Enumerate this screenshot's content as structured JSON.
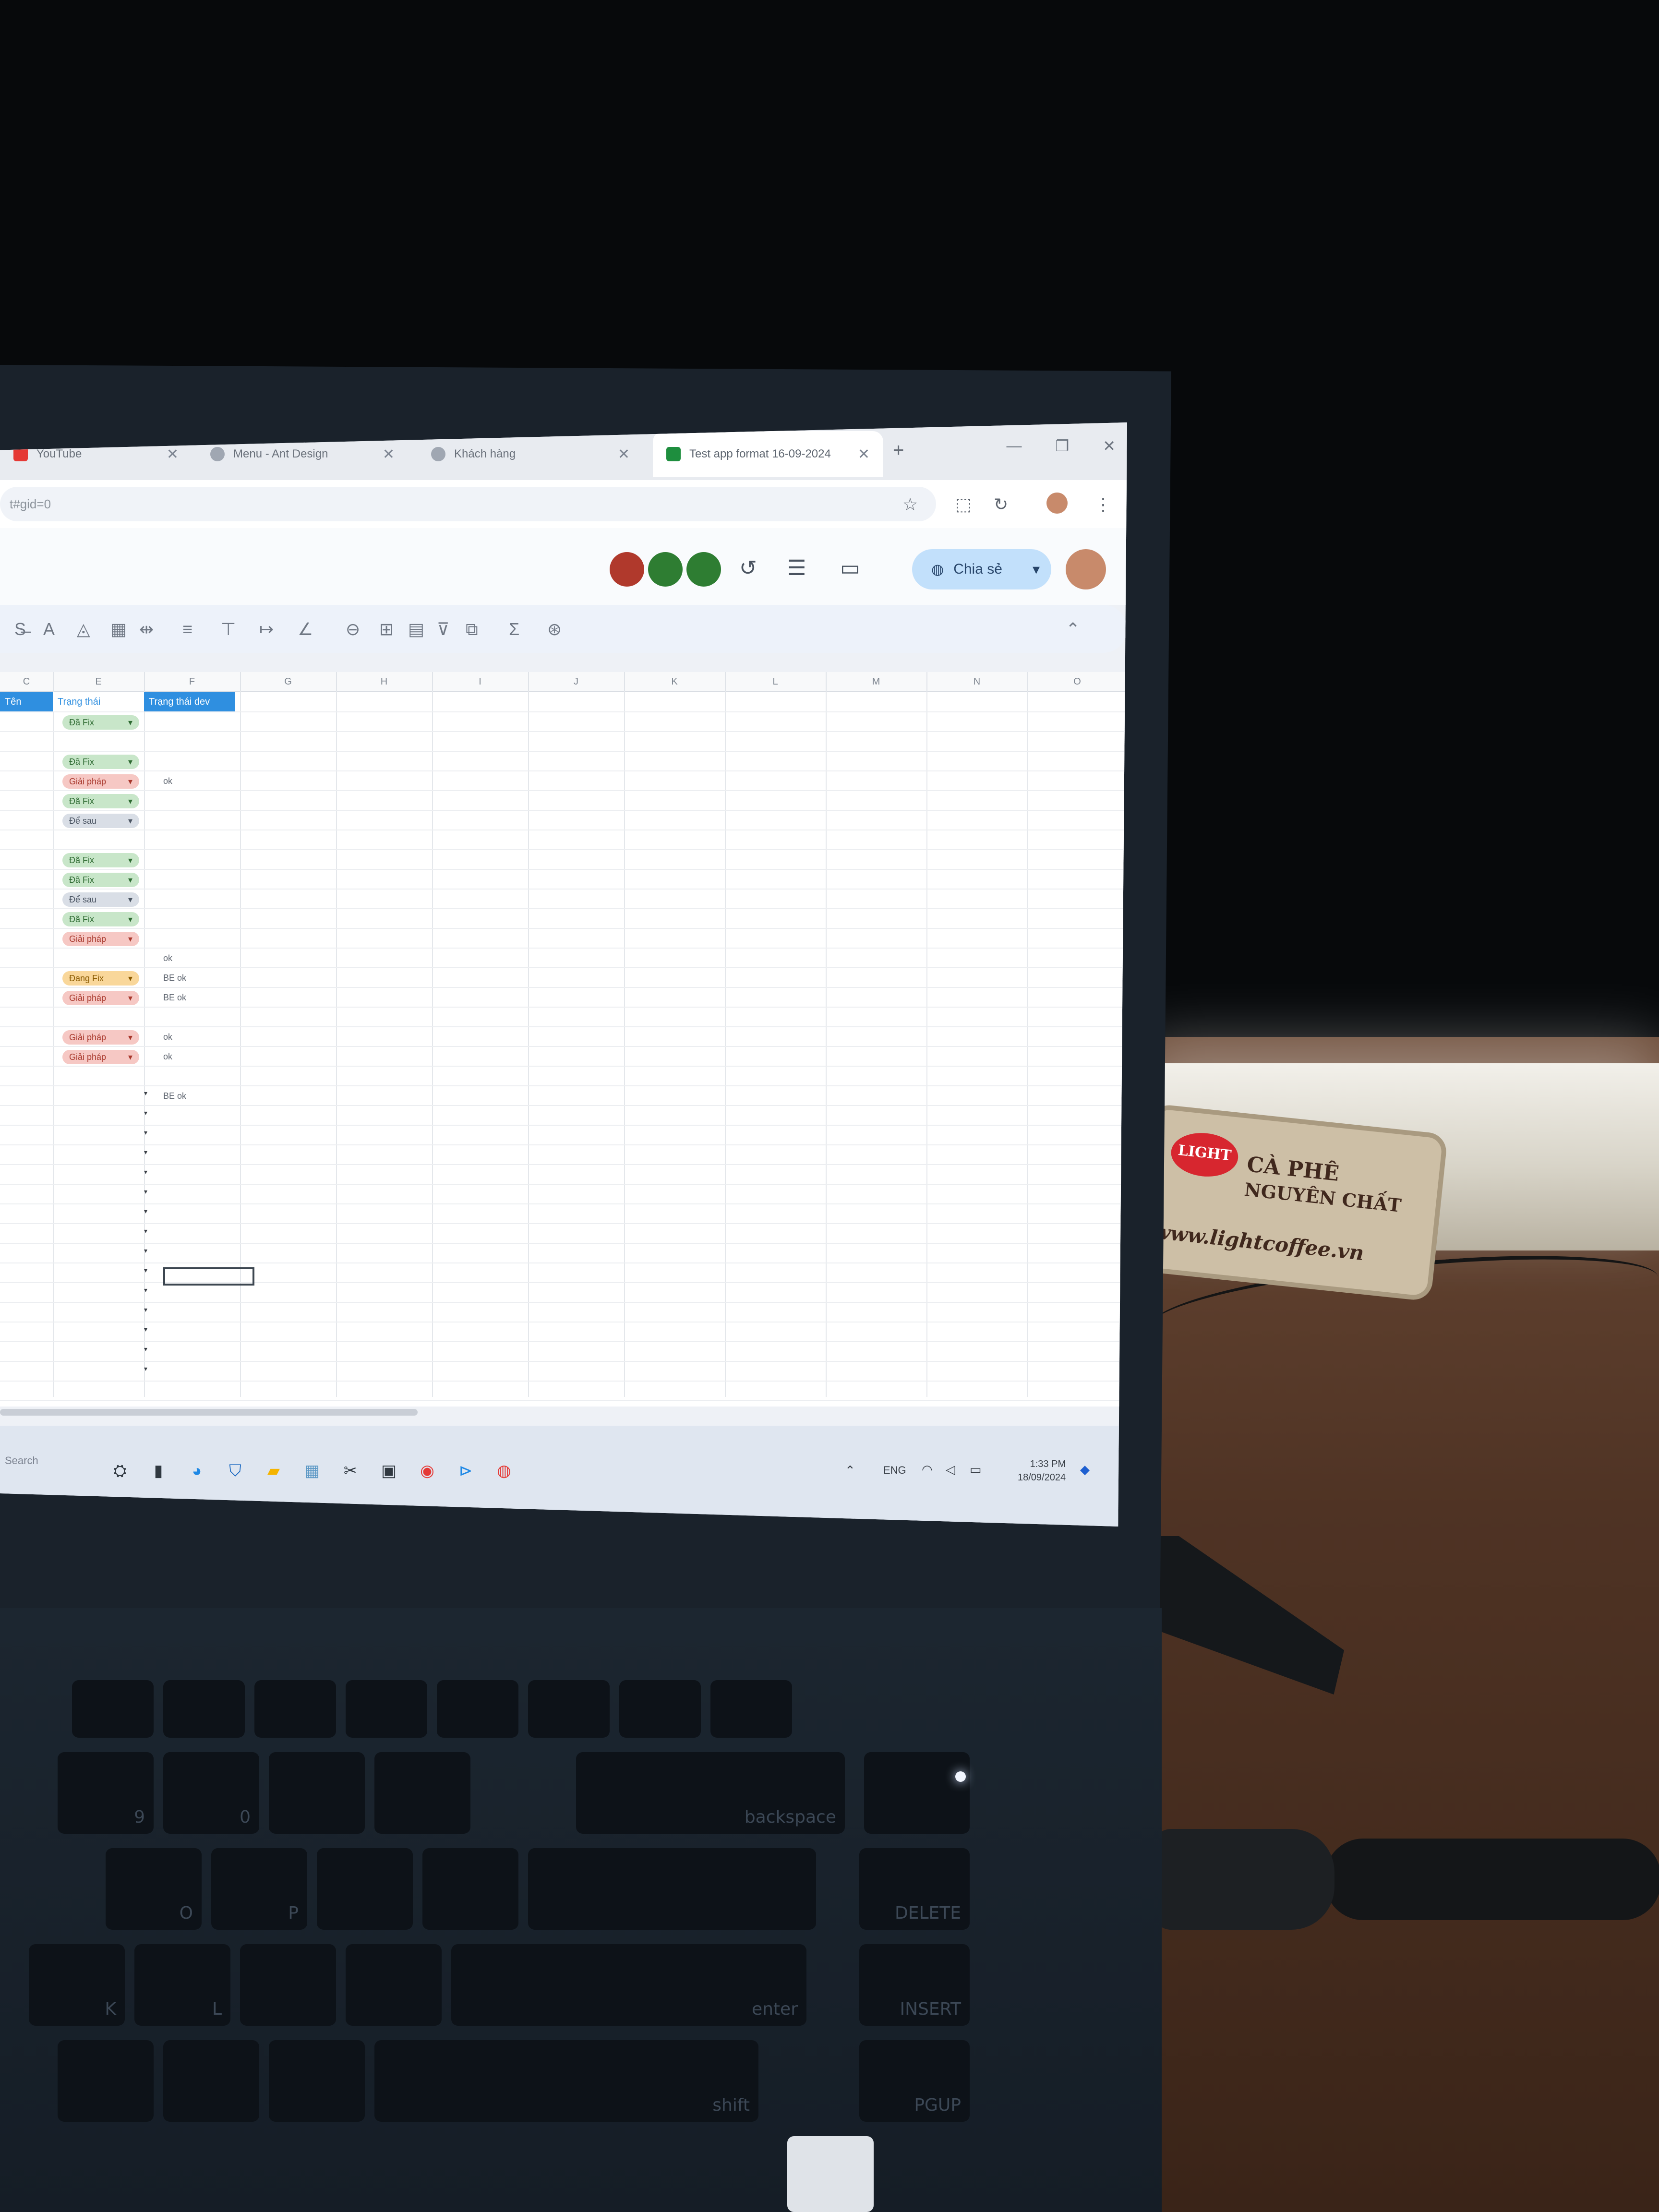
{
  "browser": {
    "tabs": [
      {
        "label": "YouTube",
        "favicon_color": "#e53935",
        "active": false
      },
      {
        "label": "Menu - Ant Design",
        "favicon_color": "#a0a7b2",
        "active": false
      },
      {
        "label": "Khách hàng",
        "favicon_color": "#a0a7b2",
        "active": false
      },
      {
        "label": "Test app format 16-09-2024",
        "favicon_color": "#1e8e3e",
        "active": true
      }
    ],
    "new_tab": "+",
    "window_controls": [
      "—",
      "❐",
      "✕"
    ],
    "url": "t#gid=0"
  },
  "sheets": {
    "share_label": "Chia sẻ",
    "collaborator_colors": [
      "#b0392c",
      "#2e7d32",
      "#2e7d32"
    ]
  },
  "grid": {
    "column_letters": [
      "C",
      "E",
      "F",
      "G",
      "H",
      "I",
      "J",
      "K",
      "L",
      "M",
      "N",
      "O"
    ],
    "headers": {
      "c": "Tên",
      "e": "Trạng thái",
      "f": "Trạng thái dev"
    },
    "status_rows": [
      {
        "label": "Đã Fix",
        "color": "green"
      },
      {
        "label": "",
        "color": "none"
      },
      {
        "label": "Đã Fix",
        "color": "green"
      },
      {
        "label": "Giải pháp",
        "color": "red"
      },
      {
        "label": "Đã Fix",
        "color": "green"
      },
      {
        "label": "Để sau",
        "color": "gray"
      },
      {
        "label": "",
        "color": "none"
      },
      {
        "label": "Đã Fix",
        "color": "green"
      },
      {
        "label": "Đã Fix",
        "color": "green"
      },
      {
        "label": "Để sau",
        "color": "gray"
      },
      {
        "label": "Đã Fix",
        "color": "green"
      },
      {
        "label": "Giải pháp",
        "color": "red"
      },
      {
        "label": "",
        "color": "none"
      },
      {
        "label": "Đang Fix",
        "color": "orange"
      },
      {
        "label": "Giải pháp",
        "color": "red"
      },
      {
        "label": "",
        "color": "none"
      },
      {
        "label": "Giải pháp",
        "color": "red"
      },
      {
        "label": "Giải pháp",
        "color": "red"
      }
    ],
    "dev_notes": [
      {
        "row": 3,
        "text": "ok"
      },
      {
        "row": 12,
        "text": "ok"
      },
      {
        "row": 13,
        "text": "BE ok"
      },
      {
        "row": 14,
        "text": "BE ok"
      },
      {
        "row": 16,
        "text": "ok"
      },
      {
        "row": 17,
        "text": "ok"
      },
      {
        "row": 19,
        "text": "BE ok"
      }
    ]
  },
  "taskbar": {
    "search_placeholder": "Search",
    "language": "ENG",
    "time": "1:33 PM",
    "date": "18/09/2024"
  },
  "scene": {
    "coaster_text_1": "CÀ PHÊ",
    "coaster_text_2": "NGUYÊN CHẤT",
    "coaster_url": "www.lightcoffee.vn",
    "coaster_brand": "LIGHT",
    "keys": {
      "backspace": "backspace",
      "delete": "DELETE",
      "insert": "INSERT",
      "enter": "enter",
      "pgup": "PGUP",
      "shift": "shift",
      "p": "P",
      "o": "O",
      "l": "L",
      "k": "K",
      "nine": "9",
      "zero": "0"
    }
  },
  "colors": {
    "chip_green_bg": "#c8e6c9",
    "chip_green_fg": "#2e6b32",
    "chip_red_bg": "#f6c8c4",
    "chip_red_fg": "#a8382c",
    "chip_gray_bg": "#d9dee6",
    "chip_gray_fg": "#4b5563",
    "chip_orange_bg": "#f9d79a",
    "chip_orange_fg": "#8a5a00",
    "header_blue": "#2f8fe0"
  }
}
